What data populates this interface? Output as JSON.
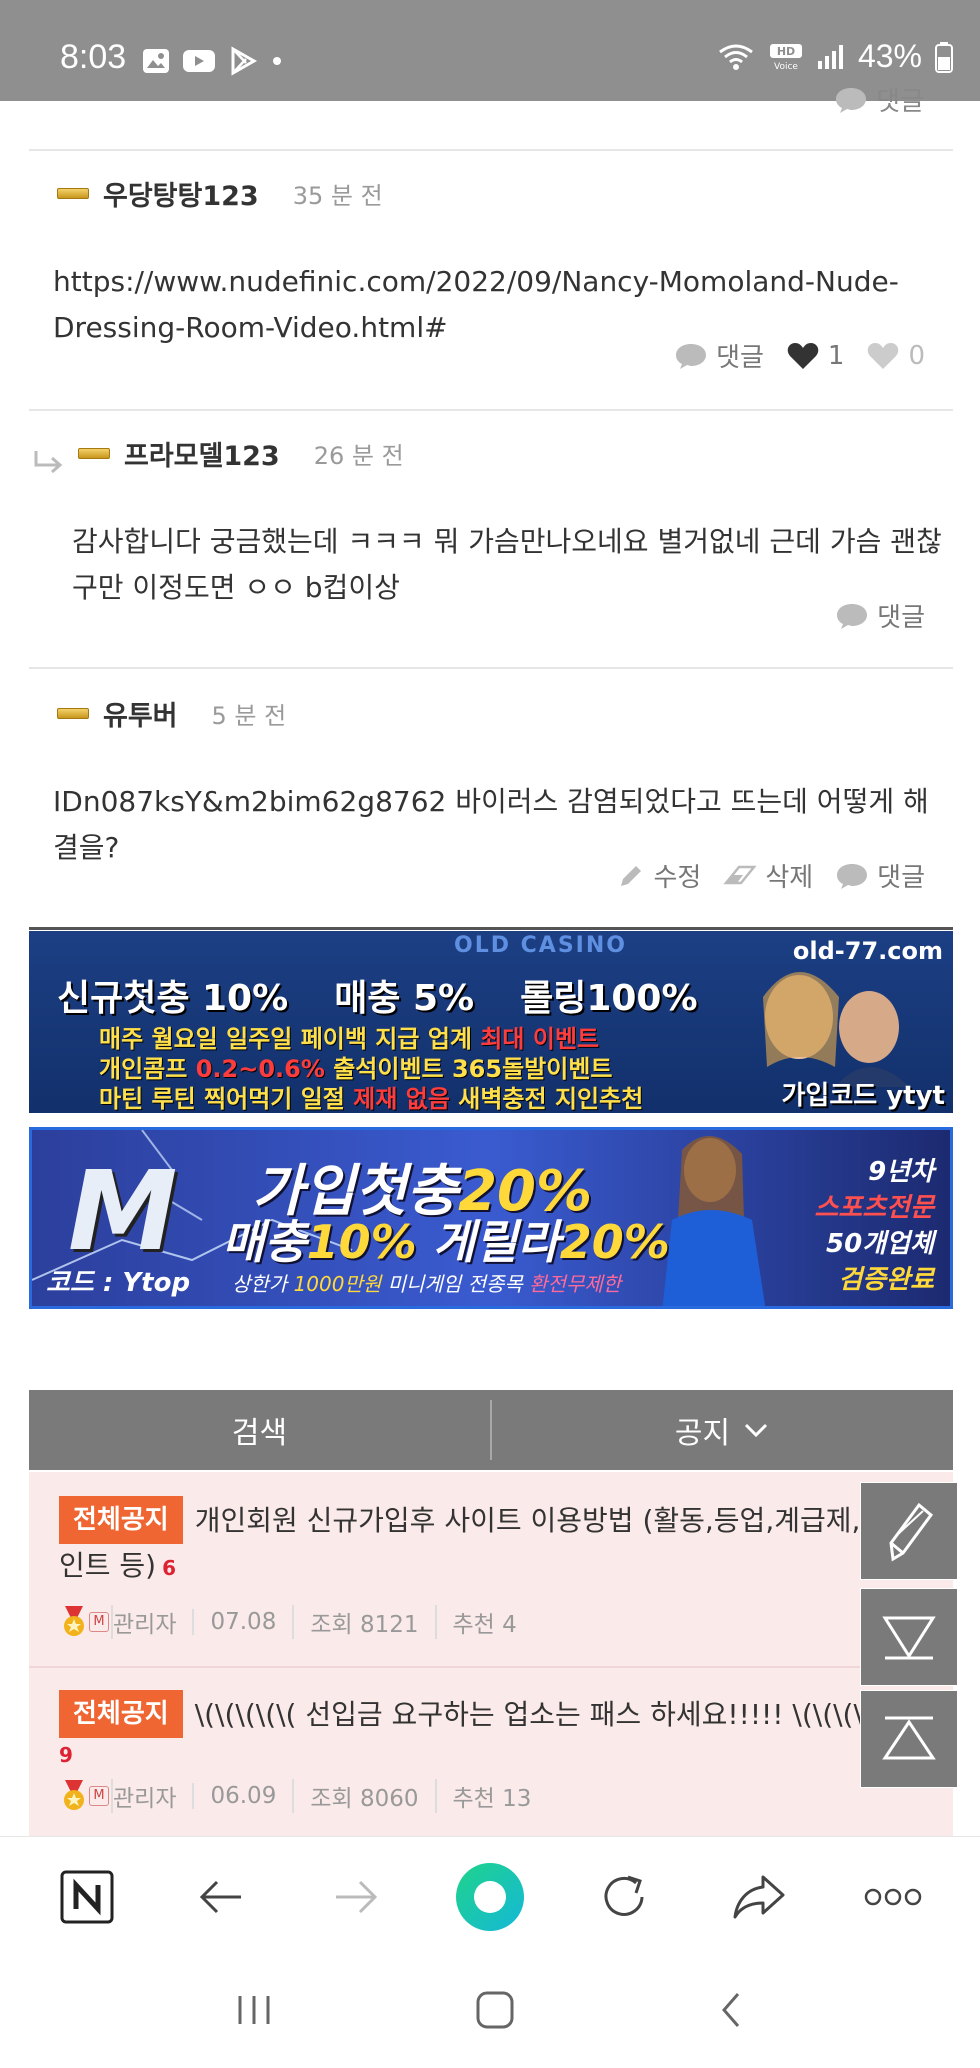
{
  "status_bar": {
    "time": "8:03",
    "battery": "43%"
  },
  "comments": [
    {
      "nickname": "우당탕탕123",
      "time_ago": "35 분 전",
      "body": "https://www.nudefinic.com/2022/09/Nancy-Momoland-Nude-Dressing-Room-Video.html#",
      "reply_label": "댓글",
      "like_count": "1",
      "dislike_count": "0"
    },
    {
      "nickname": "프라모델123",
      "time_ago": "26 분 전",
      "body": "감사합니다 궁금했는데 ㅋㅋㅋ 뭐 가슴만나오네요 별거없네 근데 가슴 괜찮구만 이정도면 ㅇㅇ b컵이상",
      "reply_label": "댓글"
    },
    {
      "nickname": "유투버",
      "time_ago": "5 분 전",
      "body": "IDn087ksY&m2bim62g8762 바이러스 감염되었다고 뜨는데 어떻게 해결을?",
      "edit_label": "수정",
      "delete_label": "삭제",
      "reply_label": "댓글"
    }
  ],
  "reply_top_label": "댓글",
  "ads": {
    "ad1": {
      "brand": "OLD CASINO",
      "url": "old-77.com",
      "line1a": "신규첫충 10%",
      "line1b": "매충 5%",
      "line1c": "롤링100%",
      "line2a": "매주 월요일 일주일 페이백 지급 업계 ",
      "line2b": "최대 이벤트",
      "line3a": "개인콤프 ",
      "line3b": "0.2~0.6%",
      "line3c": " 출석이벤트 365돌발이벤트",
      "line4a": "마틴 루틴 찍어먹기 일절 ",
      "line4b": "제재 없음",
      "line4c": " 새벽충전 지인추천",
      "code": "가입코드 ytyt"
    },
    "ad2": {
      "logo": "M",
      "line1a": "가입첫충",
      "line1b": "20%",
      "line2a": "매충",
      "line2b": "10%",
      "line2c": " 게릴라",
      "line2d": "20%",
      "code": "코드 : Ytop",
      "small_a": "상한가 ",
      "small_b": "1000만원",
      "small_c": " 미니게임 전종목 ",
      "small_d": "환전무제한",
      "side1": "9년차",
      "side2": "스포츠전문",
      "side3": "50개업체",
      "side4": "검증완료"
    }
  },
  "board": {
    "search_label": "검색",
    "notice_label": "공지",
    "notices": [
      {
        "tag": "전체공지",
        "title": "개인회원 신규가입후 사이트 이용방법 (활동,등업,계급제,포인트 등)",
        "comment_count": "6",
        "author": "관리자",
        "date": "07.08",
        "views": "조회 8121",
        "recommend": "추천 4"
      },
      {
        "tag": "전체공지",
        "title": "\\(\\(\\(\\(\\( 선입금 요구하는 업소는 패스 하세요!!!!! \\(\\(\\(\\(\\(",
        "comment_count": "9",
        "author": "관리자",
        "date": "06.09",
        "views": "조회 8060",
        "recommend": "추천 13"
      }
    ]
  },
  "icons": {
    "reply": "speech-bubble-icon",
    "like": "heart-filled-icon",
    "dislike": "heart-outline-icon",
    "edit": "pencil-icon",
    "delete": "eraser-icon",
    "write": "pen-icon",
    "scroll_down": "triangle-down-icon",
    "scroll_up": "triangle-up-icon"
  },
  "colors": {
    "status_bar": "#8f8f8f",
    "board_bar": "#7a7a7a",
    "notice_bg": "#fbeaea",
    "tag": "#ef6632"
  }
}
